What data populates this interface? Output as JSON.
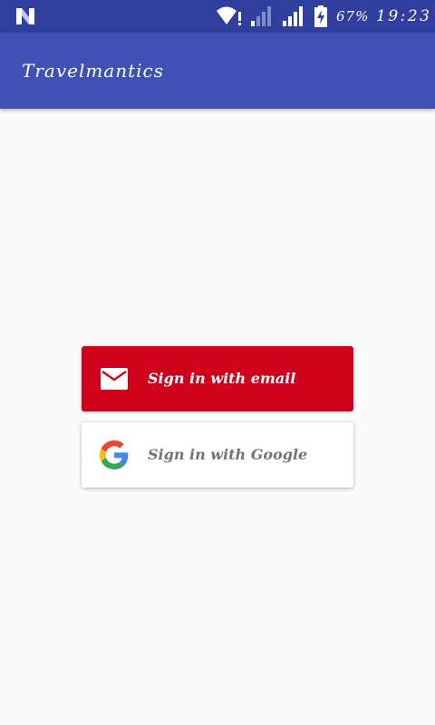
{
  "status_bar": {
    "battery_percent": "67%",
    "time": "19:23",
    "icons": [
      "android-n-icon",
      "wifi-alert-icon",
      "cell-signal-weak-icon",
      "cell-signal-icon",
      "battery-charging-icon"
    ]
  },
  "app_bar": {
    "title": "Travelmantics"
  },
  "auth": {
    "email_button_label": "Sign in with email",
    "google_button_label": "Sign in with Google"
  },
  "colors": {
    "status_bar": "#303f9f",
    "app_bar": "#3f51b5",
    "email_button": "#d0021b",
    "google_button": "#ffffff",
    "background": "#fafafa"
  }
}
